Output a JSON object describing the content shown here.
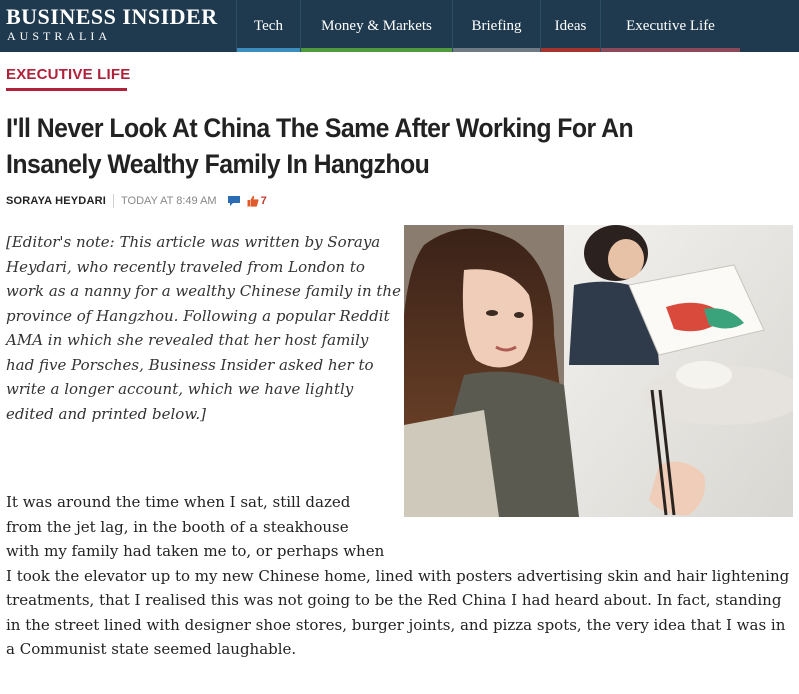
{
  "header": {
    "logo_main": "BUSINESS INSIDER",
    "logo_sub": "AUSTRALIA",
    "nav": [
      {
        "label": "Tech",
        "accent": "#3b8dbd"
      },
      {
        "label": "Money & Markets",
        "accent": "#4e9a3d"
      },
      {
        "label": "Briefing",
        "accent": "#6f7b84"
      },
      {
        "label": "Ideas",
        "accent": "#a7332f"
      },
      {
        "label": "Executive Life",
        "accent": "#8b4a5a"
      }
    ]
  },
  "article": {
    "category": "EXECUTIVE LIFE",
    "headline": "I'll Never Look At China The Same After Working For An Insanely Wealthy Family In Hangzhou",
    "author": "SORAYA HEYDARI",
    "time": "TODAY AT 8:49 AM",
    "like_count": "7",
    "editor_note": "[Editor's note: This article was written by Soraya Heydari, who recently traveled from London to work as a nanny for a wealthy Chinese family in the province of Hangzhou. Following a popular Reddit AMA in which she revealed that her host family had five Porsches, Business Insider asked her to write a longer account, which we have lightly edited and printed below.]",
    "paragraph_1": "It was around the time when I sat, still dazed from the jet lag, in the booth of a steakhouse with my family had taken me to, or perhaps when I took the elevator up to my new Chinese home, lined with posters advertising skin and hair lightening treatments, that I realised this was not going to be the Red China I had heard about. In fact, standing in the street lined with designer shoe stores, burger joints, and pizza spots, the very idea that I was in a Communist state seemed laughable."
  },
  "colors": {
    "nav_background": "#1f3a4e",
    "category_red": "#b0213a",
    "comment_blue": "#2a6db5",
    "like_red": "#c0392b"
  },
  "icons": [
    "comment-icon",
    "like-hand-icon"
  ]
}
